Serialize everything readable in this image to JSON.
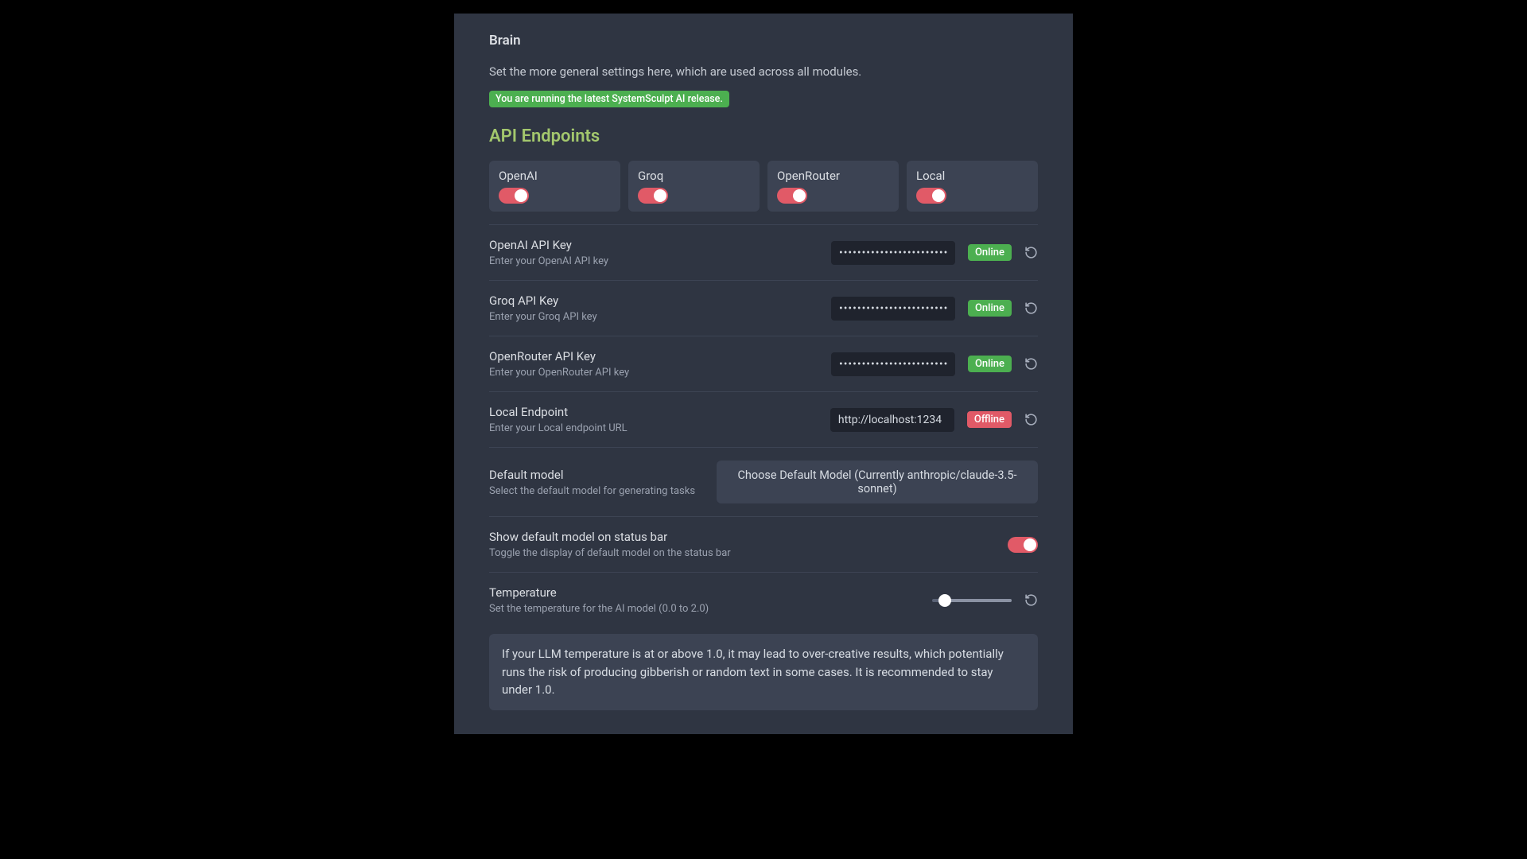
{
  "header": {
    "title": "Brain",
    "description": "Set the more general settings here, which are used across all modules.",
    "release_badge": "You are running the latest SystemSculpt AI release."
  },
  "section": {
    "api_endpoints_heading": "API Endpoints"
  },
  "endpoints": [
    {
      "label": "OpenAI"
    },
    {
      "label": "Groq"
    },
    {
      "label": "OpenRouter"
    },
    {
      "label": "Local"
    }
  ],
  "settings": {
    "openai_key": {
      "title": "OpenAI API Key",
      "desc": "Enter your OpenAI API key",
      "value": "••••••••••••••••••••••••",
      "status": "Online"
    },
    "groq_key": {
      "title": "Groq API Key",
      "desc": "Enter your Groq API key",
      "value": "••••••••••••••••••••••••",
      "status": "Online"
    },
    "openrouter_key": {
      "title": "OpenRouter API Key",
      "desc": "Enter your OpenRouter API key",
      "value": "••••••••••••••••••••••••",
      "status": "Online"
    },
    "local_endpoint": {
      "title": "Local Endpoint",
      "desc": "Enter your Local endpoint URL",
      "value": "http://localhost:1234",
      "status": "Offline"
    },
    "default_model": {
      "title": "Default model",
      "desc": "Select the default model for generating tasks",
      "button": "Choose Default Model (Currently anthropic/claude-3.5-sonnet)"
    },
    "show_status_bar": {
      "title": "Show default model on status bar",
      "desc": "Toggle the display of default model on the status bar"
    },
    "temperature": {
      "title": "Temperature",
      "desc": "Set the temperature for the AI model (0.0 to 2.0)"
    }
  },
  "info": {
    "temperature_warning": "If your LLM temperature is at or above 1.0, it may lead to over-creative results, which potentially runs the risk of producing gibberish or random text in some cases. It is recommended to stay under 1.0."
  }
}
